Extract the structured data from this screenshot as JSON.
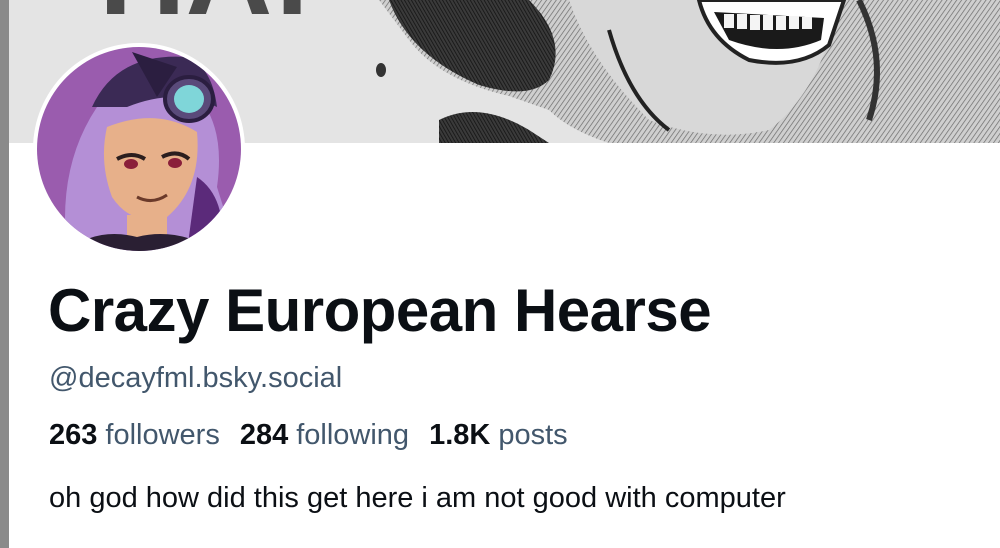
{
  "profile": {
    "display_name": "Crazy European Hearse",
    "handle": "@decayfml.bsky.social",
    "bio": "oh god how did this get here i am not good with computer",
    "banner_text": "HA!",
    "stats": [
      {
        "count": "263",
        "label": "followers"
      },
      {
        "count": "284",
        "label": "following"
      },
      {
        "count": "1.8K",
        "label": "posts"
      }
    ]
  },
  "colors": {
    "name_text": "#0b0f14",
    "secondary_text": "#42576c",
    "avatar_bg": "#9a5cae"
  }
}
